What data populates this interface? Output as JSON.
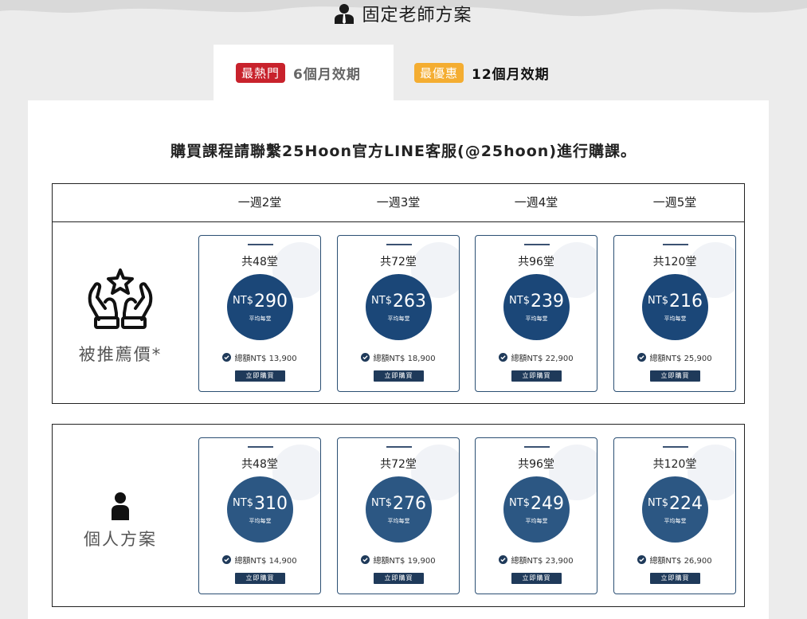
{
  "page_title": "固定老師方案",
  "tabs": [
    {
      "badge": "最熱門",
      "badge_color": "#c8222c",
      "label": "6個月效期",
      "active": true
    },
    {
      "badge": "最優惠",
      "badge_color": "#f4ad31",
      "label": "12個月效期",
      "active": false
    }
  ],
  "notice": "購買課程請聯繫25Hoon官方LINE客服(@25hoon)進行購課。",
  "columns": [
    "一週2堂",
    "一週3堂",
    "一週4堂",
    "一週5堂"
  ],
  "plans": [
    {
      "label": "被推薦價*",
      "icon": "hands-star-icon",
      "cards": [
        {
          "count": "共48堂",
          "currency": "NT$",
          "price": "290",
          "per": "平均每堂",
          "total": "總額NT$ 13,900",
          "buy": "立即購買"
        },
        {
          "count": "共72堂",
          "currency": "NT$",
          "price": "263",
          "per": "平均每堂",
          "total": "總額NT$ 18,900",
          "buy": "立即購買"
        },
        {
          "count": "共96堂",
          "currency": "NT$",
          "price": "239",
          "per": "平均每堂",
          "total": "總額NT$ 22,900",
          "buy": "立即購買"
        },
        {
          "count": "共120堂",
          "currency": "NT$",
          "price": "216",
          "per": "平均每堂",
          "total": "總額NT$ 25,900",
          "buy": "立即購買"
        }
      ]
    },
    {
      "label": "個人方案",
      "icon": "person-icon",
      "cards": [
        {
          "count": "共48堂",
          "currency": "NT$",
          "price": "310",
          "per": "平均每堂",
          "total": "總額NT$ 14,900",
          "buy": "立即購買"
        },
        {
          "count": "共72堂",
          "currency": "NT$",
          "price": "276",
          "per": "平均每堂",
          "total": "總額NT$ 19,900",
          "buy": "立即購買"
        },
        {
          "count": "共96堂",
          "currency": "NT$",
          "price": "249",
          "per": "平均每堂",
          "total": "總額NT$ 23,900",
          "buy": "立即購買"
        },
        {
          "count": "共120堂",
          "currency": "NT$",
          "price": "224",
          "per": "平均每堂",
          "total": "總額NT$ 26,900",
          "buy": "立即購買"
        }
      ]
    }
  ]
}
